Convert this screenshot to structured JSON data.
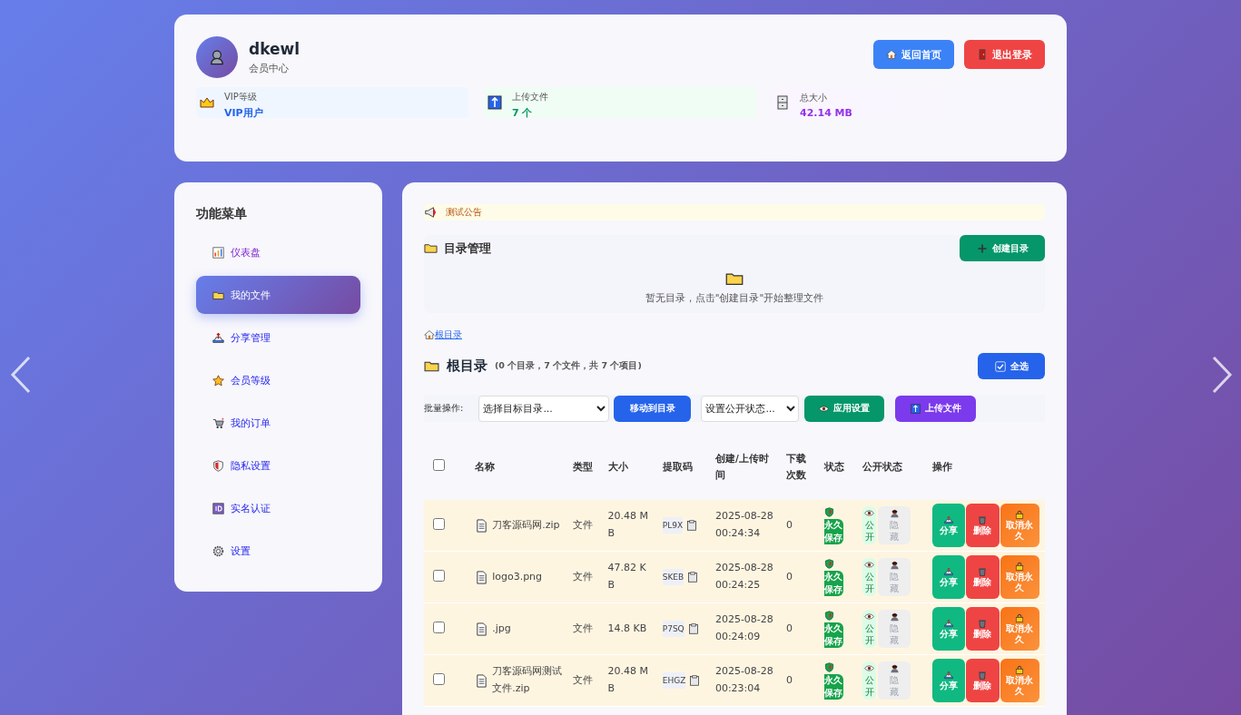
{
  "user": {
    "name": "dkewl",
    "subtitle": "会员中心"
  },
  "header_buttons": [
    {
      "label": "返回首页",
      "kind": "home"
    },
    {
      "label": "退出登录",
      "kind": "logout"
    }
  ],
  "stats": [
    {
      "label": "VIP等级",
      "value": "VIP用户",
      "kind": "vip"
    },
    {
      "label": "上传文件",
      "value": "7 个",
      "kind": "files"
    },
    {
      "label": "总大小",
      "value": "42.14 MB",
      "kind": "size"
    }
  ],
  "sidebar": {
    "title": "功能菜单",
    "items": [
      {
        "label": "仪表盘",
        "selected": false,
        "visited": true
      },
      {
        "label": "我的文件",
        "selected": true,
        "visited": false
      },
      {
        "label": "分享管理",
        "selected": false,
        "visited": false
      },
      {
        "label": "会员等级",
        "selected": false,
        "visited": false
      },
      {
        "label": "我的订单",
        "selected": false,
        "visited": false
      },
      {
        "label": "隐私设置",
        "selected": false,
        "visited": false
      },
      {
        "label": "实名认证",
        "selected": false,
        "visited": false
      },
      {
        "label": "设置",
        "selected": false,
        "visited": false
      }
    ]
  },
  "announcement": "测试公告",
  "directory": {
    "title": "目录管理",
    "create_button": "创建目录",
    "empty_text": "暂无目录，点击\"创建目录\"开始整理文件"
  },
  "breadcrumb": "根目录",
  "folder": {
    "title": "根目录",
    "summary": "(0 个目录，7 个文件，共 7 个项目)",
    "select_all": "全选"
  },
  "batch": {
    "label": "批量操作:",
    "target_select": "选择目标目录...",
    "move_button": "移动到目录",
    "public_select": "设置公开状态...",
    "apply_button": "应用设置",
    "upload_button": "上传文件"
  },
  "table": {
    "select_all_checked": false,
    "columns": [
      "名称",
      "类型",
      "大小",
      "提取码",
      "创建/上传时间",
      "下载次数",
      "状态",
      "公开状态",
      "操作"
    ],
    "rows": [
      {
        "checked": false,
        "name": "刀客源码网.zip",
        "type": "文件",
        "size": "20.48 MB",
        "code": "PL9X",
        "created": "2025-08-28 00:24:34",
        "downloads": "0",
        "status": "永久保存",
        "visibility": [
          {
            "label": "公开",
            "selected": true
          },
          {
            "label": "隐藏",
            "selected": false
          }
        ],
        "actions": [
          {
            "label": "分享",
            "kind": "share"
          },
          {
            "label": "删除",
            "kind": "delete"
          },
          {
            "label": "取消永久",
            "kind": "unpin"
          }
        ]
      },
      {
        "checked": false,
        "name": "logo3.png",
        "type": "文件",
        "size": "47.82 KB",
        "code": "SKEB",
        "created": "2025-08-28 00:24:25",
        "downloads": "0",
        "status": "永久保存",
        "visibility": [
          {
            "label": "公开",
            "selected": true
          },
          {
            "label": "隐藏",
            "selected": false
          }
        ],
        "actions": [
          {
            "label": "分享",
            "kind": "share"
          },
          {
            "label": "删除",
            "kind": "delete"
          },
          {
            "label": "取消永久",
            "kind": "unpin"
          }
        ]
      },
      {
        "checked": false,
        "name": ".jpg",
        "type": "文件",
        "size": "14.8 KB",
        "code": "P7SQ",
        "created": "2025-08-28 00:24:09",
        "downloads": "0",
        "status": "永久保存",
        "visibility": [
          {
            "label": "公开",
            "selected": true
          },
          {
            "label": "隐藏",
            "selected": false
          }
        ],
        "actions": [
          {
            "label": "分享",
            "kind": "share"
          },
          {
            "label": "删除",
            "kind": "delete"
          },
          {
            "label": "取消永久",
            "kind": "unpin"
          }
        ]
      },
      {
        "checked": false,
        "name": "刀客源码网测试文件.zip",
        "type": "文件",
        "size": "20.48 MB",
        "code": "EHGZ",
        "created": "2025-08-28 00:23:04",
        "downloads": "0",
        "status": "永久保存",
        "visibility": [
          {
            "label": "公开",
            "selected": true
          },
          {
            "label": "隐藏",
            "selected": false
          }
        ],
        "actions": [
          {
            "label": "分享",
            "kind": "share"
          },
          {
            "label": "删除",
            "kind": "delete"
          },
          {
            "label": "取消永久",
            "kind": "unpin"
          }
        ]
      }
    ]
  }
}
